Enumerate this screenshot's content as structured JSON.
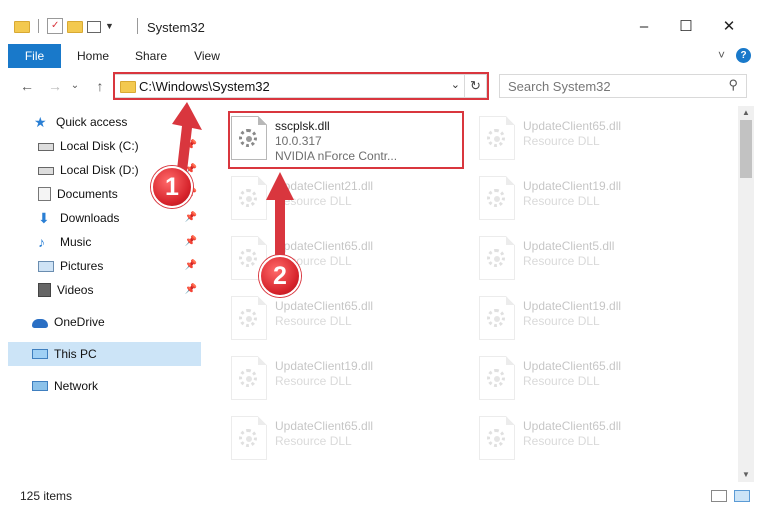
{
  "window": {
    "title": "System32",
    "controls": {
      "minimize": "–",
      "maximize": "☐",
      "close": "✕"
    }
  },
  "ribbon": {
    "tabs": [
      "File",
      "Home",
      "Share",
      "View"
    ],
    "collapse_icon": "˅",
    "help_icon": "?"
  },
  "nav": {
    "back": "←",
    "forward": "→",
    "dropdown": "⌄",
    "up": "↑",
    "address": "C:\\Windows\\System32",
    "address_dropdown": "⌄",
    "refresh": "↻",
    "search_placeholder": "Search System32",
    "search_icon": "⚲"
  },
  "sidebar": {
    "items": [
      {
        "label": "Quick access",
        "icon": "star-icon",
        "pinned": false
      },
      {
        "label": "Local Disk (C:)",
        "icon": "drive-icon",
        "pinned": true
      },
      {
        "label": "Local Disk (D:)",
        "icon": "drive-icon",
        "pinned": true
      },
      {
        "label": "Documents",
        "icon": "documents-icon",
        "pinned": true
      },
      {
        "label": "Downloads",
        "icon": "download-icon",
        "pinned": true
      },
      {
        "label": "Music",
        "icon": "music-icon",
        "pinned": true
      },
      {
        "label": "Pictures",
        "icon": "pictures-icon",
        "pinned": true
      },
      {
        "label": "Videos",
        "icon": "videos-icon",
        "pinned": true
      },
      {
        "label": "OneDrive",
        "icon": "cloud-icon",
        "pinned": false
      },
      {
        "label": "This PC",
        "icon": "computer-icon",
        "pinned": false,
        "selected": true
      },
      {
        "label": "Network",
        "icon": "network-icon",
        "pinned": false
      }
    ]
  },
  "files": [
    {
      "name": "sscplsk.dll",
      "line2": "10.0.317",
      "line3": "NVIDIA nForce Contr...",
      "highlight": true
    },
    {
      "name": "UpdateClient65.dll",
      "line2": "Resource DLL"
    },
    {
      "name": "UpdateClient21.dll",
      "line2": "Resource DLL"
    },
    {
      "name": "UpdateClient19.dll",
      "line2": "Resource DLL"
    },
    {
      "name": "UpdateClient65.dll",
      "line2": "Resource DLL"
    },
    {
      "name": "UpdateClient5.dll",
      "line2": "Resource DLL"
    },
    {
      "name": "UpdateClient65.dll",
      "line2": "Resource DLL"
    },
    {
      "name": "UpdateClient19.dll",
      "line2": "Resource DLL"
    },
    {
      "name": "UpdateClient19.dll",
      "line2": "Resource DLL"
    },
    {
      "name": "UpdateClient65.dll",
      "line2": "Resource DLL"
    },
    {
      "name": "UpdateClient65.dll",
      "line2": "Resource DLL"
    },
    {
      "name": "UpdateClient65.dll",
      "line2": "Resource DLL"
    }
  ],
  "status": {
    "item_count": "125 items"
  },
  "annotations": {
    "step1": "1",
    "step2": "2",
    "color": "#d9363e"
  },
  "colors": {
    "accent": "#1979ca",
    "selected_bg": "#cce4f7",
    "highlight_red": "#d9363e"
  }
}
